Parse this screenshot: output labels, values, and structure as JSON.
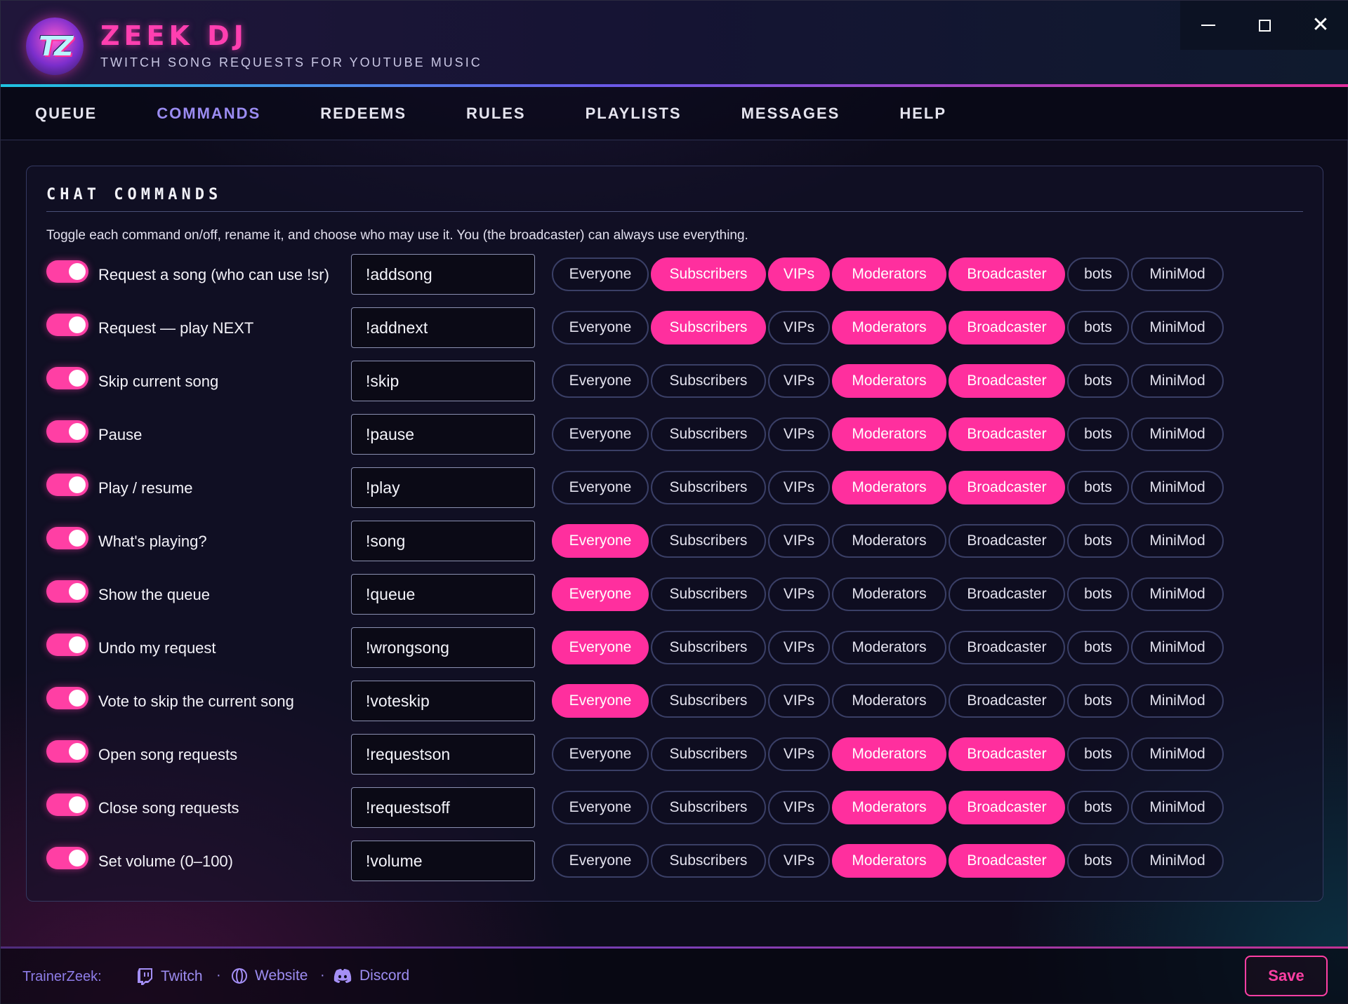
{
  "app": {
    "logo_text": "TZ",
    "title": "ZEEK DJ",
    "subtitle": "TWITCH SONG REQUESTS FOR YOUTUBE MUSIC"
  },
  "tabs": [
    "QUEUE",
    "COMMANDS",
    "REDEEMS",
    "RULES",
    "PLAYLISTS",
    "MESSAGES",
    "HELP"
  ],
  "active_tab": "COMMANDS",
  "panel": {
    "title": "CHAT COMMANDS",
    "description": "Toggle each command on/off, rename it, and choose who may use it. You (the broadcaster) can always use everything."
  },
  "roles": [
    "Everyone",
    "Subscribers",
    "VIPs",
    "Moderators",
    "Broadcaster",
    "bots",
    "MiniMod"
  ],
  "commands": [
    {
      "label": "Request a song (who can use !sr)",
      "command": "!addsong",
      "enabled": true,
      "allowed": [
        "Subscribers",
        "VIPs",
        "Moderators",
        "Broadcaster"
      ]
    },
    {
      "label": "Request — play NEXT",
      "command": "!addnext",
      "enabled": true,
      "allowed": [
        "Subscribers",
        "Moderators",
        "Broadcaster"
      ]
    },
    {
      "label": "Skip current song",
      "command": "!skip",
      "enabled": true,
      "allowed": [
        "Moderators",
        "Broadcaster"
      ]
    },
    {
      "label": "Pause",
      "command": "!pause",
      "enabled": true,
      "allowed": [
        "Moderators",
        "Broadcaster"
      ]
    },
    {
      "label": "Play / resume",
      "command": "!play",
      "enabled": true,
      "allowed": [
        "Moderators",
        "Broadcaster"
      ]
    },
    {
      "label": "What's playing?",
      "command": "!song",
      "enabled": true,
      "allowed": [
        "Everyone"
      ]
    },
    {
      "label": "Show the queue",
      "command": "!queue",
      "enabled": true,
      "allowed": [
        "Everyone"
      ]
    },
    {
      "label": "Undo my request",
      "command": "!wrongsong",
      "enabled": true,
      "allowed": [
        "Everyone"
      ]
    },
    {
      "label": "Vote to skip the current song",
      "command": "!voteskip",
      "enabled": true,
      "allowed": [
        "Everyone"
      ]
    },
    {
      "label": "Open song requests",
      "command": "!requestson",
      "enabled": true,
      "allowed": [
        "Moderators",
        "Broadcaster"
      ]
    },
    {
      "label": "Close song requests",
      "command": "!requestsoff",
      "enabled": true,
      "allowed": [
        "Moderators",
        "Broadcaster"
      ]
    },
    {
      "label": "Set volume (0–100)",
      "command": "!volume",
      "enabled": true,
      "allowed": [
        "Moderators",
        "Broadcaster"
      ]
    }
  ],
  "footer": {
    "credit": "TrainerZeek:",
    "links": [
      {
        "label": "Twitch",
        "icon": "twitch-icon"
      },
      {
        "label": "Website",
        "icon": "globe-icon"
      },
      {
        "label": "Discord",
        "icon": "discord-icon"
      }
    ],
    "separator": "·",
    "save_label": "Save"
  },
  "colors": {
    "accent_pink": "#ff2f9e",
    "accent_purple": "#9b8cf2",
    "background": "#0d0c1c"
  }
}
